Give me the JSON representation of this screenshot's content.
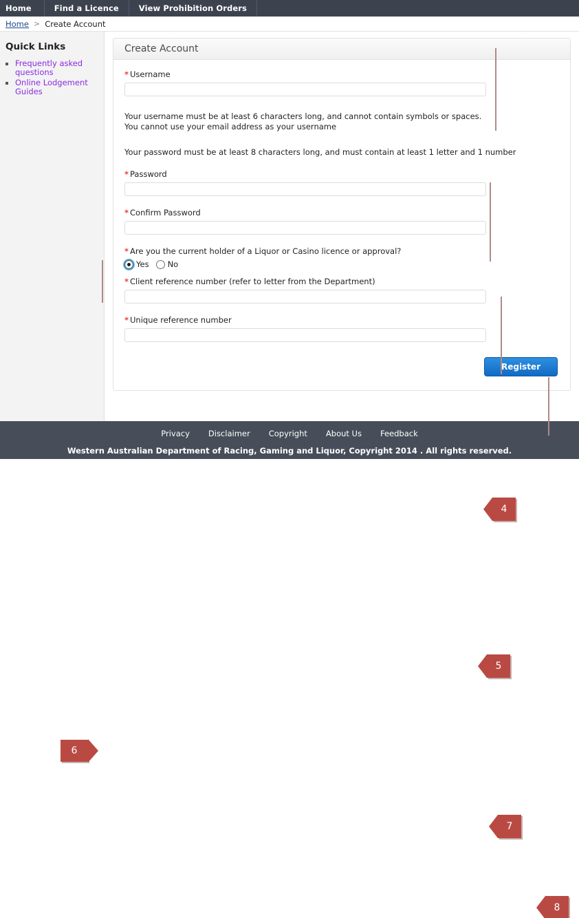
{
  "topnav": {
    "items": [
      {
        "label": "Home"
      },
      {
        "label": "Find a Licence"
      },
      {
        "label": "View Prohibition Orders"
      }
    ]
  },
  "breadcrumb": {
    "home": "Home",
    "separator": ">",
    "current": "Create Account"
  },
  "sidebar": {
    "title": "Quick Links",
    "links": [
      {
        "label": "Frequently asked questions"
      },
      {
        "label": "Online Lodgement Guides"
      }
    ]
  },
  "form": {
    "panel_title": "Create Account",
    "required_marker": "*",
    "username": {
      "label": "Username",
      "value": "",
      "placeholder": ""
    },
    "username_help_line1": "Your username must be at least 6 characters long, and cannot contain symbols or spaces.",
    "username_help_line2": "You cannot use your email address as your username",
    "password_help": "Your password must be at least 8 characters long, and must contain at least 1 letter and 1 number",
    "password": {
      "label": "Password",
      "value": "",
      "placeholder": ""
    },
    "confirm_password": {
      "label": "Confirm Password",
      "value": "",
      "placeholder": ""
    },
    "licence_holder": {
      "label": "Are you the current holder of a Liquor or Casino licence or approval?",
      "options": [
        {
          "label": "Yes",
          "selected": true
        },
        {
          "label": "No",
          "selected": false
        }
      ]
    },
    "client_reference": {
      "label": "Client reference number (refer to letter from the Department)",
      "value": "",
      "placeholder": ""
    },
    "unique_reference": {
      "label": "Unique reference number",
      "value": "",
      "placeholder": ""
    },
    "register_button": "Register"
  },
  "annotations": [
    {
      "number": "4",
      "direction": "left"
    },
    {
      "number": "5",
      "direction": "left"
    },
    {
      "number": "6",
      "direction": "right"
    },
    {
      "number": "7",
      "direction": "left"
    },
    {
      "number": "8",
      "direction": "left"
    }
  ],
  "footer": {
    "links": [
      {
        "label": "Privacy"
      },
      {
        "label": "Disclaimer"
      },
      {
        "label": "Copyright"
      },
      {
        "label": "About Us"
      },
      {
        "label": "Feedback"
      }
    ],
    "copyright": "Western Australian Department of Racing, Gaming and Liquor, Copyright 2014 . All rights reserved."
  },
  "colors": {
    "nav_bg": "#3d434e",
    "footer_bg": "#474e59",
    "accent_red": "#e8403a",
    "annotation_red": "#b94a43",
    "button_blue": "#0f6bc4",
    "link_purple": "#8a2be2",
    "breadcrumb_link": "#1a4b8c"
  }
}
